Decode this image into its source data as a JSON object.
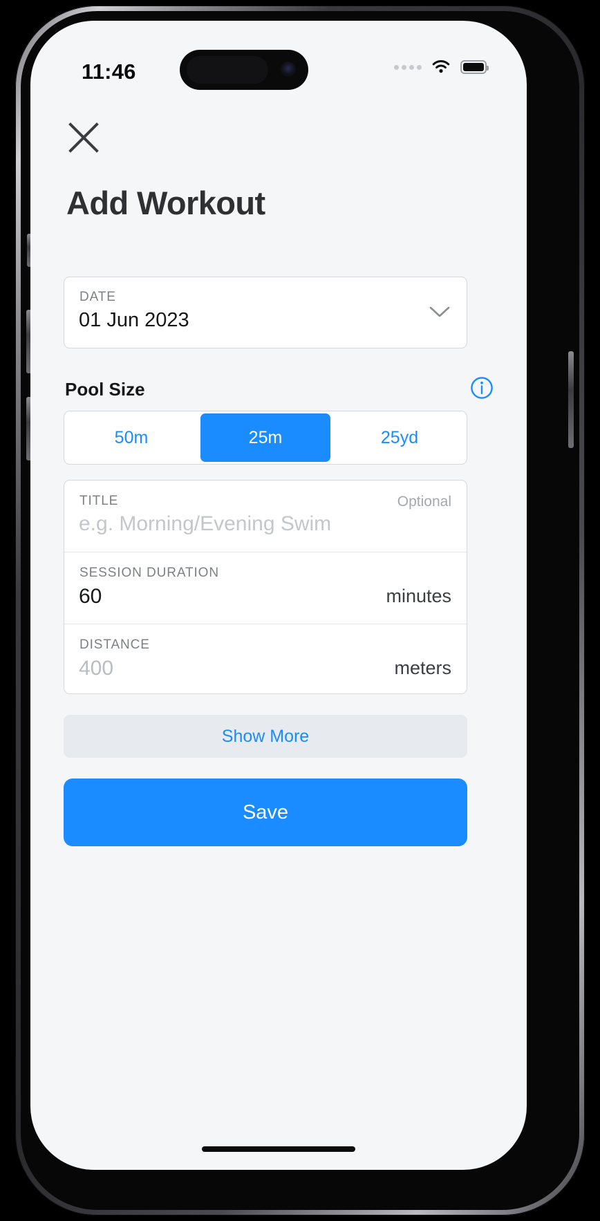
{
  "status_bar": {
    "time": "11:46",
    "signal_icon": "signal-dots-icon",
    "wifi_icon": "wifi-icon",
    "battery_icon": "battery-icon"
  },
  "header": {
    "close_icon": "close-x-icon",
    "title": "Add Workout"
  },
  "date_field": {
    "label": "DATE",
    "value": "01 Jun 2023",
    "chevron_icon": "chevron-down-icon"
  },
  "pool_size": {
    "heading": "Pool Size",
    "info_icon": "info-circle-icon",
    "options": [
      {
        "label": "50m",
        "selected": false
      },
      {
        "label": "25m",
        "selected": true
      },
      {
        "label": "25yd",
        "selected": false
      }
    ],
    "selected_value": "25m"
  },
  "form": {
    "title_row": {
      "label": "TITLE",
      "optional": "Optional",
      "placeholder": "e.g. Morning/Evening Swim",
      "value": ""
    },
    "duration_row": {
      "label": "SESSION DURATION",
      "value": "60",
      "unit": "minutes"
    },
    "distance_row": {
      "label": "DISTANCE",
      "placeholder": "400",
      "value": "",
      "unit": "meters"
    }
  },
  "actions": {
    "show_more": "Show More",
    "save": "Save"
  },
  "colors": {
    "accent": "#1a8cff",
    "page_bg": "#f4f6f8",
    "card_bg": "#ffffff",
    "border": "#d5d8dc",
    "muted_text": "#7c8085"
  }
}
